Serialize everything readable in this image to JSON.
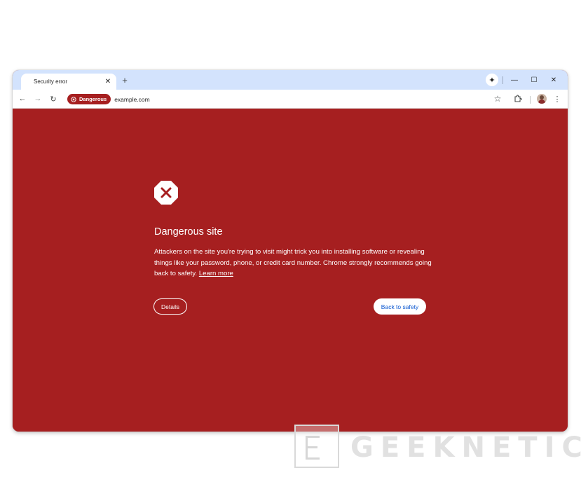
{
  "browser": {
    "tab": {
      "title": "Security error",
      "close_glyph": "✕"
    },
    "new_tab_glyph": "+",
    "gemini_glyph": "✦",
    "window_controls": {
      "minimize": "—",
      "maximize": "☐",
      "close": "✕"
    },
    "toolbar": {
      "back_glyph": "←",
      "forward_glyph": "→",
      "reload_glyph": "↻",
      "security_chip_label": "Dangerous",
      "url": "example.com",
      "bookmark_glyph": "☆",
      "menu_glyph": "⋮"
    }
  },
  "interstitial": {
    "heading": "Dangerous site",
    "body": "Attackers on the site you're trying to visit might trick you into installing software or revealing things like your password, phone, or credit card number. Chrome strongly recommends going back to safety.",
    "learn_more": "Learn more",
    "details_button": "Details",
    "back_button": "Back to safety"
  },
  "watermark": {
    "text": "GEEKNETIC"
  },
  "colors": {
    "danger_red": "#a61f20",
    "tabstrip_blue": "#d3e3fd",
    "link_blue": "#0b57d0"
  }
}
